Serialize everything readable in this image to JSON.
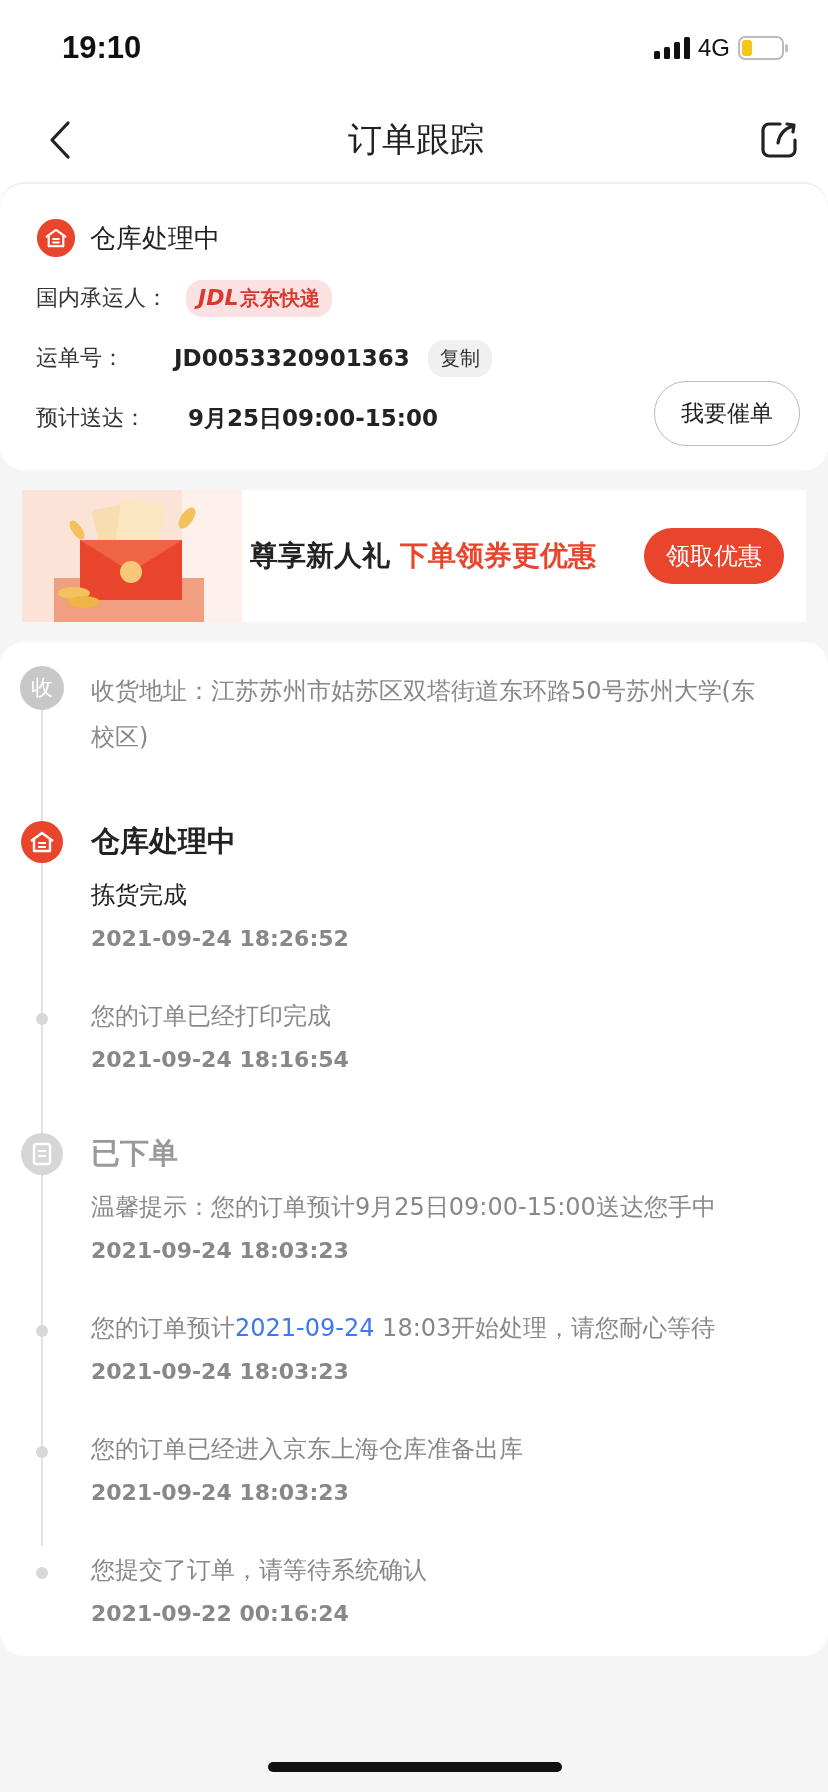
{
  "status_bar": {
    "time": "19:10",
    "network": "4G"
  },
  "nav": {
    "title": "订单跟踪"
  },
  "status_card": {
    "status": "仓库处理中",
    "carrier_label": "国内承运人：",
    "carrier_logo": "JDL",
    "carrier_name": "京东快递",
    "waybill_label": "运单号：",
    "waybill": "JD0053320901363",
    "copy_button": "复制",
    "eta_label": "预计送达：",
    "eta": "9月25日09:00-15:00",
    "urge_button": "我要催单"
  },
  "banner": {
    "title": "尊享新人礼",
    "highlight": "下单领券更优惠",
    "button": "领取优惠"
  },
  "timeline": {
    "address": {
      "badge": "收",
      "text": "收货地址：江苏苏州市姑苏区双塔街道东环路50号苏州大学(东校区)"
    },
    "groups": [
      {
        "title": "仓库处理中",
        "kind": "warehouse",
        "active": true,
        "events": [
          {
            "segments": [
              {
                "text": "拣货完成",
                "highlight": false
              }
            ],
            "time": "2021-09-24 18:26:52"
          },
          {
            "segments": [
              {
                "text": "您的订单已经打印完成",
                "highlight": false
              }
            ],
            "time": "2021-09-24 18:16:54"
          }
        ]
      },
      {
        "title": "已下单",
        "kind": "ordered",
        "active": false,
        "events": [
          {
            "segments": [
              {
                "text": "温馨提示：您的订单预计9月25日09:00-15:00送达您手中",
                "highlight": false
              }
            ],
            "time": "2021-09-24 18:03:23"
          },
          {
            "segments": [
              {
                "text": "您的订单预计",
                "highlight": false
              },
              {
                "text": "2021-09-24",
                "highlight": true
              },
              {
                "text": " 18:03开始处理，请您耐心等待",
                "highlight": false
              }
            ],
            "time": "2021-09-24 18:03:23"
          },
          {
            "segments": [
              {
                "text": "您的订单已经进入京东上海仓库准备出库",
                "highlight": false
              }
            ],
            "time": "2021-09-24 18:03:23"
          },
          {
            "segments": [
              {
                "text": "您提交了订单，请等待系统确认",
                "highlight": false
              }
            ],
            "time": "2021-09-22 00:16:24"
          }
        ]
      }
    ]
  }
}
